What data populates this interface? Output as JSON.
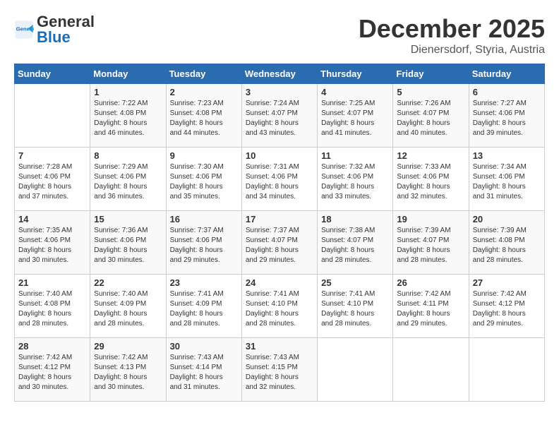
{
  "header": {
    "logo_general": "General",
    "logo_blue": "Blue",
    "month": "December 2025",
    "location": "Dienersdorf, Styria, Austria"
  },
  "weekdays": [
    "Sunday",
    "Monday",
    "Tuesday",
    "Wednesday",
    "Thursday",
    "Friday",
    "Saturday"
  ],
  "weeks": [
    [
      {
        "day": "",
        "info": ""
      },
      {
        "day": "1",
        "info": "Sunrise: 7:22 AM\nSunset: 4:08 PM\nDaylight: 8 hours\nand 46 minutes."
      },
      {
        "day": "2",
        "info": "Sunrise: 7:23 AM\nSunset: 4:08 PM\nDaylight: 8 hours\nand 44 minutes."
      },
      {
        "day": "3",
        "info": "Sunrise: 7:24 AM\nSunset: 4:07 PM\nDaylight: 8 hours\nand 43 minutes."
      },
      {
        "day": "4",
        "info": "Sunrise: 7:25 AM\nSunset: 4:07 PM\nDaylight: 8 hours\nand 41 minutes."
      },
      {
        "day": "5",
        "info": "Sunrise: 7:26 AM\nSunset: 4:07 PM\nDaylight: 8 hours\nand 40 minutes."
      },
      {
        "day": "6",
        "info": "Sunrise: 7:27 AM\nSunset: 4:06 PM\nDaylight: 8 hours\nand 39 minutes."
      }
    ],
    [
      {
        "day": "7",
        "info": "Sunrise: 7:28 AM\nSunset: 4:06 PM\nDaylight: 8 hours\nand 37 minutes."
      },
      {
        "day": "8",
        "info": "Sunrise: 7:29 AM\nSunset: 4:06 PM\nDaylight: 8 hours\nand 36 minutes."
      },
      {
        "day": "9",
        "info": "Sunrise: 7:30 AM\nSunset: 4:06 PM\nDaylight: 8 hours\nand 35 minutes."
      },
      {
        "day": "10",
        "info": "Sunrise: 7:31 AM\nSunset: 4:06 PM\nDaylight: 8 hours\nand 34 minutes."
      },
      {
        "day": "11",
        "info": "Sunrise: 7:32 AM\nSunset: 4:06 PM\nDaylight: 8 hours\nand 33 minutes."
      },
      {
        "day": "12",
        "info": "Sunrise: 7:33 AM\nSunset: 4:06 PM\nDaylight: 8 hours\nand 32 minutes."
      },
      {
        "day": "13",
        "info": "Sunrise: 7:34 AM\nSunset: 4:06 PM\nDaylight: 8 hours\nand 31 minutes."
      }
    ],
    [
      {
        "day": "14",
        "info": "Sunrise: 7:35 AM\nSunset: 4:06 PM\nDaylight: 8 hours\nand 30 minutes."
      },
      {
        "day": "15",
        "info": "Sunrise: 7:36 AM\nSunset: 4:06 PM\nDaylight: 8 hours\nand 30 minutes."
      },
      {
        "day": "16",
        "info": "Sunrise: 7:37 AM\nSunset: 4:06 PM\nDaylight: 8 hours\nand 29 minutes."
      },
      {
        "day": "17",
        "info": "Sunrise: 7:37 AM\nSunset: 4:07 PM\nDaylight: 8 hours\nand 29 minutes."
      },
      {
        "day": "18",
        "info": "Sunrise: 7:38 AM\nSunset: 4:07 PM\nDaylight: 8 hours\nand 28 minutes."
      },
      {
        "day": "19",
        "info": "Sunrise: 7:39 AM\nSunset: 4:07 PM\nDaylight: 8 hours\nand 28 minutes."
      },
      {
        "day": "20",
        "info": "Sunrise: 7:39 AM\nSunset: 4:08 PM\nDaylight: 8 hours\nand 28 minutes."
      }
    ],
    [
      {
        "day": "21",
        "info": "Sunrise: 7:40 AM\nSunset: 4:08 PM\nDaylight: 8 hours\nand 28 minutes."
      },
      {
        "day": "22",
        "info": "Sunrise: 7:40 AM\nSunset: 4:09 PM\nDaylight: 8 hours\nand 28 minutes."
      },
      {
        "day": "23",
        "info": "Sunrise: 7:41 AM\nSunset: 4:09 PM\nDaylight: 8 hours\nand 28 minutes."
      },
      {
        "day": "24",
        "info": "Sunrise: 7:41 AM\nSunset: 4:10 PM\nDaylight: 8 hours\nand 28 minutes."
      },
      {
        "day": "25",
        "info": "Sunrise: 7:41 AM\nSunset: 4:10 PM\nDaylight: 8 hours\nand 28 minutes."
      },
      {
        "day": "26",
        "info": "Sunrise: 7:42 AM\nSunset: 4:11 PM\nDaylight: 8 hours\nand 29 minutes."
      },
      {
        "day": "27",
        "info": "Sunrise: 7:42 AM\nSunset: 4:12 PM\nDaylight: 8 hours\nand 29 minutes."
      }
    ],
    [
      {
        "day": "28",
        "info": "Sunrise: 7:42 AM\nSunset: 4:12 PM\nDaylight: 8 hours\nand 30 minutes."
      },
      {
        "day": "29",
        "info": "Sunrise: 7:42 AM\nSunset: 4:13 PM\nDaylight: 8 hours\nand 30 minutes."
      },
      {
        "day": "30",
        "info": "Sunrise: 7:43 AM\nSunset: 4:14 PM\nDaylight: 8 hours\nand 31 minutes."
      },
      {
        "day": "31",
        "info": "Sunrise: 7:43 AM\nSunset: 4:15 PM\nDaylight: 8 hours\nand 32 minutes."
      },
      {
        "day": "",
        "info": ""
      },
      {
        "day": "",
        "info": ""
      },
      {
        "day": "",
        "info": ""
      }
    ]
  ]
}
